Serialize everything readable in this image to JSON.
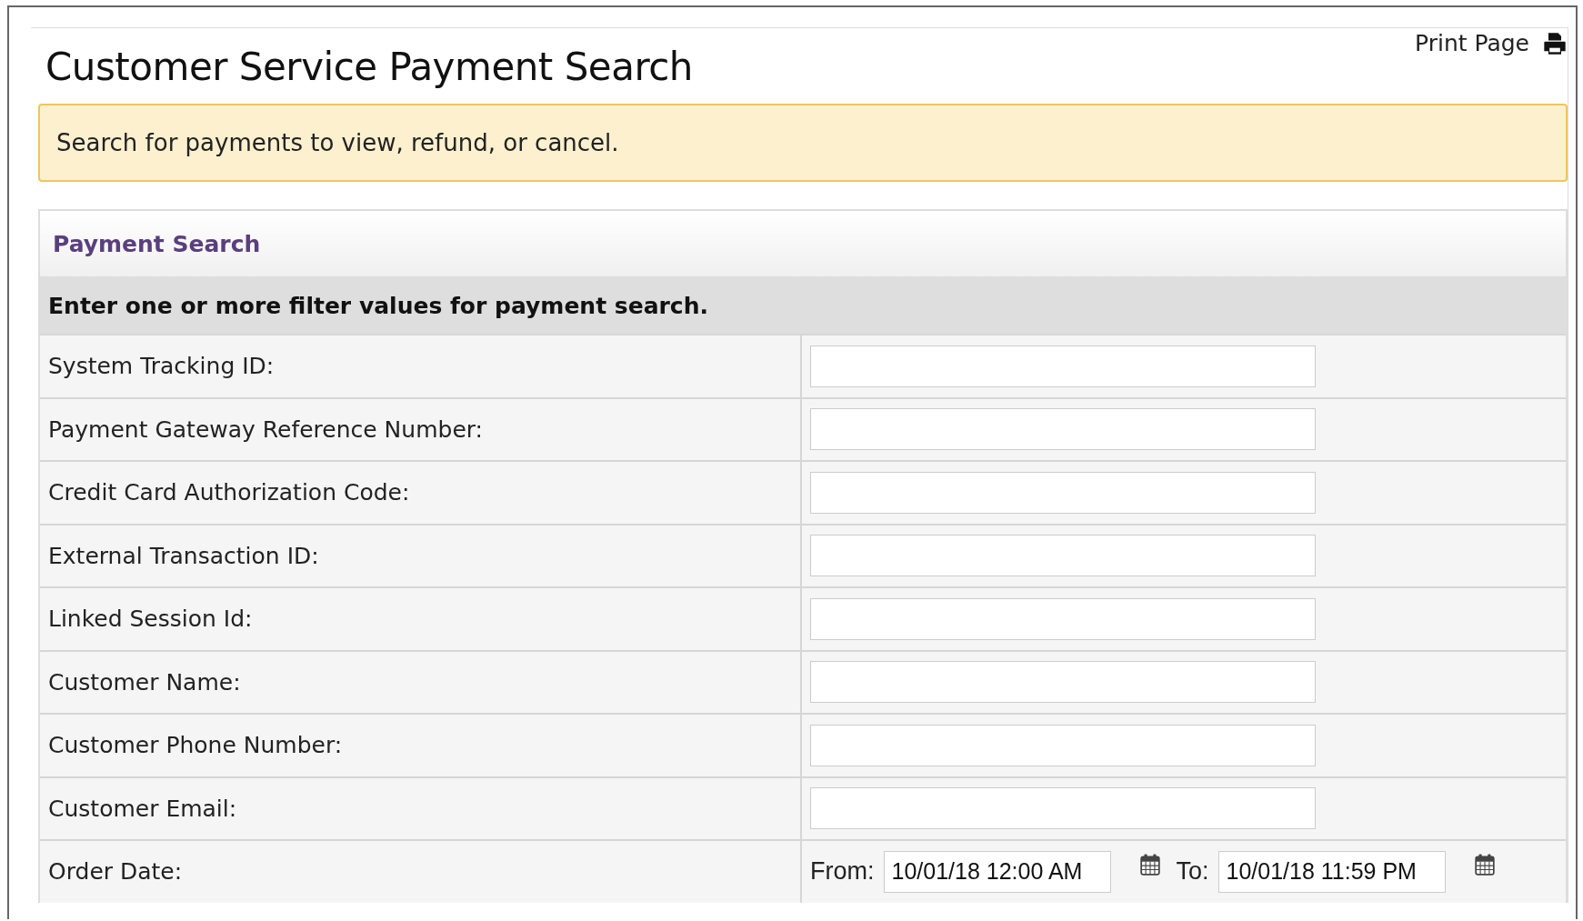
{
  "page": {
    "title": "Customer Service Payment Search",
    "print_link": "Print Page"
  },
  "alert": {
    "message": "Search for payments to view, refund, or cancel."
  },
  "panel": {
    "title": "Payment Search",
    "instructions": "Enter one or more filter values for payment search.",
    "fields": [
      {
        "kind": "text",
        "label": "System Tracking ID:"
      },
      {
        "kind": "text",
        "label": "Payment Gateway Reference Number:"
      },
      {
        "kind": "text",
        "label": "Credit Card Authorization Code:"
      },
      {
        "kind": "text",
        "label": "External Transaction ID:"
      },
      {
        "kind": "text",
        "label": "Linked Session Id:"
      },
      {
        "kind": "text",
        "label": "Customer Name:"
      },
      {
        "kind": "text",
        "label": "Customer Phone Number:"
      },
      {
        "kind": "text",
        "label": "Customer Email:"
      },
      {
        "kind": "date_range",
        "label": "Order Date:",
        "from_label": "From:",
        "from_value": "10/01/18 12:00 AM",
        "to_label": "To:",
        "to_value": "10/01/18 11:59 PM"
      }
    ]
  }
}
